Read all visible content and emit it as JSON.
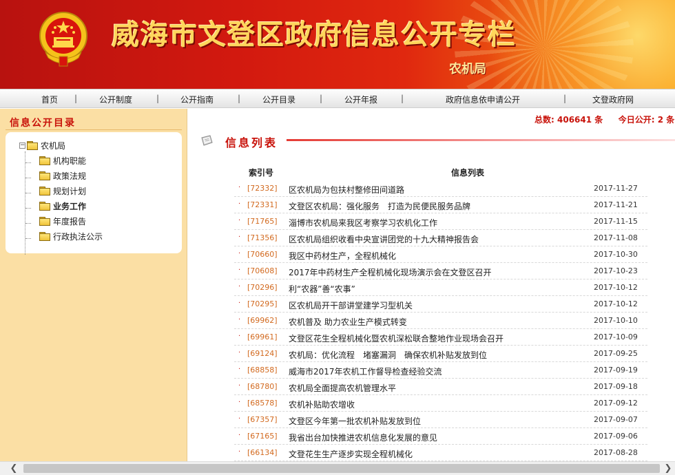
{
  "header": {
    "title": "威海市文登区政府信息公开专栏",
    "subtitle": "农机局"
  },
  "nav": {
    "items": [
      "首页",
      "公开制度",
      "公开指南",
      "公开目录",
      "公开年报",
      "政府信息依申请公开",
      "文登政府网"
    ],
    "separator": "|"
  },
  "sidebar": {
    "title": "信息公开目录",
    "root": {
      "label": "农机局",
      "expander": "−"
    },
    "items": [
      {
        "label": "机构职能",
        "bold": false
      },
      {
        "label": "政策法规",
        "bold": false
      },
      {
        "label": "规划计划",
        "bold": false
      },
      {
        "label": "业务工作",
        "bold": true
      },
      {
        "label": "年度报告",
        "bold": false
      },
      {
        "label": "行政执法公示",
        "bold": false
      }
    ]
  },
  "stats": {
    "total_label": "总数:",
    "total_value": "406641",
    "unit": "条",
    "today_label": "今日公开:",
    "today_value": "2",
    "today_unit": "条"
  },
  "list": {
    "heading": "信息列表",
    "col_index": "索引号",
    "col_title": "信息列表",
    "bullet": "·",
    "rows": [
      {
        "index": "[72332]",
        "title": "区农机局为包扶村整修田间道路",
        "date": "2017-11-27"
      },
      {
        "index": "[72331]",
        "title": "文登区农机局：强化服务　打造为民便民服务品牌",
        "date": "2017-11-21"
      },
      {
        "index": "[71765]",
        "title": "淄博市农机局来我区考察学习农机化工作",
        "date": "2017-11-15"
      },
      {
        "index": "[71356]",
        "title": "区农机局组织收看中央宣讲团党的十九大精神报告会",
        "date": "2017-11-08"
      },
      {
        "index": "[70660]",
        "title": "我区中药材生产，全程机械化",
        "date": "2017-10-30"
      },
      {
        "index": "[70608]",
        "title": "2017年中药材生产全程机械化现场演示会在文登区召开",
        "date": "2017-10-23"
      },
      {
        "index": "[70296]",
        "title": "利“农器”善“农事”",
        "date": "2017-10-12"
      },
      {
        "index": "[70295]",
        "title": "区农机局开干部讲堂建学习型机关",
        "date": "2017-10-12"
      },
      {
        "index": "[69962]",
        "title": "农机普及 助力农业生产模式转变",
        "date": "2017-10-10"
      },
      {
        "index": "[69961]",
        "title": "文登区花生全程机械化暨农机深松联合整地作业现场会召开",
        "date": "2017-10-09"
      },
      {
        "index": "[69124]",
        "title": "农机局：优化流程　堵塞漏洞　确保农机补贴发放到位",
        "date": "2017-09-25"
      },
      {
        "index": "[68858]",
        "title": "威海市2017年农机工作督导检查经验交流",
        "date": "2017-09-19"
      },
      {
        "index": "[68780]",
        "title": "农机局全面提高农机管理水平",
        "date": "2017-09-18"
      },
      {
        "index": "[68578]",
        "title": "农机补贴助农增收",
        "date": "2017-09-12"
      },
      {
        "index": "[67357]",
        "title": "文登区今年第一批农机补贴发放到位",
        "date": "2017-09-07"
      },
      {
        "index": "[67165]",
        "title": "我省出台加快推进农机信息化发展的意见",
        "date": "2017-09-06"
      },
      {
        "index": "[66134]",
        "title": "文登花生生产逐步实现全程机械化",
        "date": "2017-08-28"
      }
    ]
  },
  "scrollbar": {
    "left_arrow": "❮",
    "right_arrow": "❯"
  },
  "colors": {
    "brand_red": "#c8120a",
    "index_orange": "#d2691e",
    "sidebar_bg": "#fbdfa4"
  },
  "icons": {
    "emblem": "national-emblem-icon",
    "folder": "folder-icon",
    "list": "document-icon"
  }
}
